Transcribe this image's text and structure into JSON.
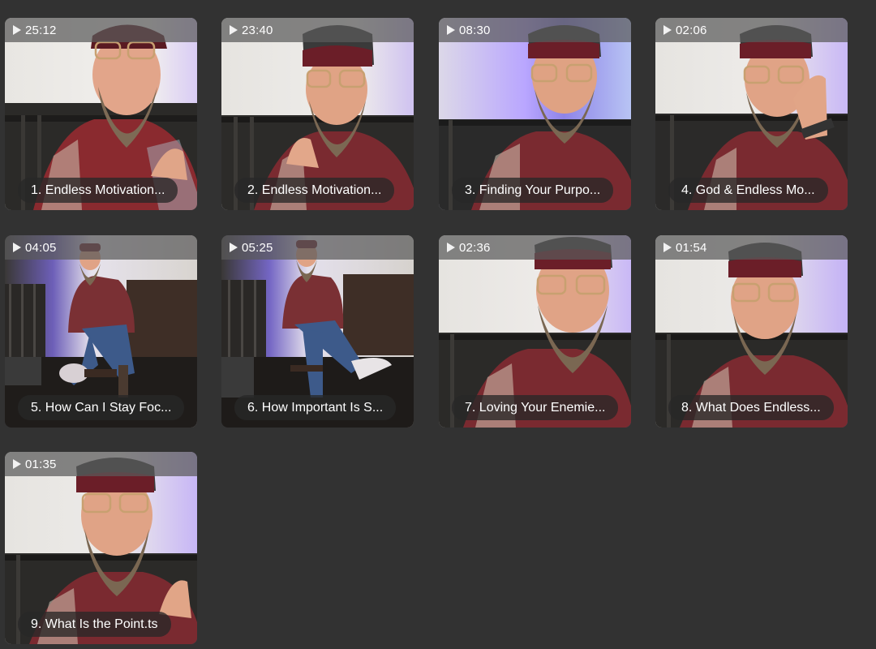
{
  "videos": [
    {
      "duration": "25:12",
      "title": "1. Endless Motivation..."
    },
    {
      "duration": "23:40",
      "title": "2. Endless Motivation..."
    },
    {
      "duration": "08:30",
      "title": "3. Finding Your Purpo..."
    },
    {
      "duration": "02:06",
      "title": "4. God & Endless Mo..."
    },
    {
      "duration": "04:05",
      "title": "5. How Can I Stay Foc..."
    },
    {
      "duration": "05:25",
      "title": "6. How Important Is S..."
    },
    {
      "duration": "02:36",
      "title": "7. Loving Your Enemie..."
    },
    {
      "duration": "01:54",
      "title": "8. What Does Endless..."
    },
    {
      "duration": "01:35",
      "title": "9. What Is the Point.ts"
    }
  ],
  "icons": {
    "play": "play-icon"
  },
  "colors": {
    "background": "#323232",
    "accent_light": "#b9a6ff"
  }
}
